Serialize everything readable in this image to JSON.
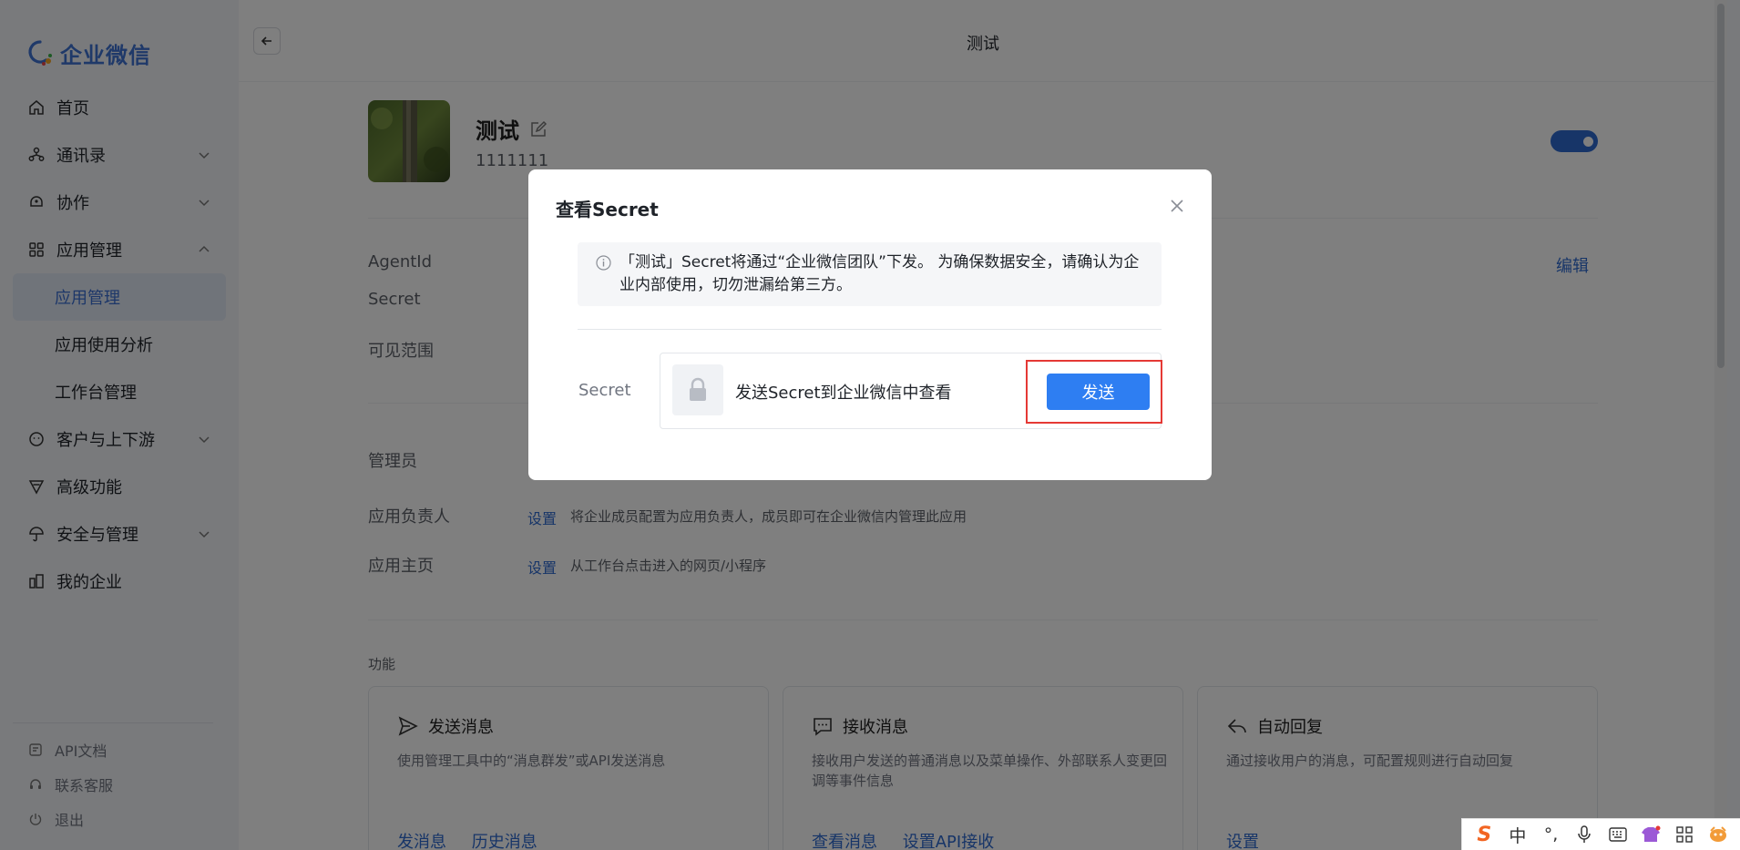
{
  "brand": {
    "name": "企业微信"
  },
  "sidebar": {
    "items": [
      {
        "label": "首页",
        "icon": "home-icon"
      },
      {
        "label": "通讯录",
        "icon": "contacts-icon"
      },
      {
        "label": "协作",
        "icon": "collab-icon"
      },
      {
        "label": "应用管理",
        "icon": "apps-icon"
      },
      {
        "label": "应用管理",
        "sub": true,
        "active": true
      },
      {
        "label": "应用使用分析",
        "sub": true
      },
      {
        "label": "工作台管理",
        "sub": true
      },
      {
        "label": "客户与上下游",
        "icon": "customer-icon"
      },
      {
        "label": "高级功能",
        "icon": "advanced-icon"
      },
      {
        "label": "安全与管理",
        "icon": "security-icon"
      },
      {
        "label": "我的企业",
        "icon": "company-icon"
      }
    ],
    "footer": [
      {
        "label": "API文档"
      },
      {
        "label": "联系客服"
      },
      {
        "label": "退出"
      }
    ]
  },
  "header": {
    "title": "测试"
  },
  "app": {
    "name": "测试",
    "id": "1111111"
  },
  "details": {
    "agentid_label": "AgentId",
    "secret_label": "Secret",
    "visible_label": "可见范围",
    "edit_label": "编辑",
    "admin_label": "管理员",
    "owner_label": "应用负责人",
    "owner_link": "设置",
    "owner_desc": "将企业成员配置为应用负责人，成员即可在企业微信内管理此应用",
    "home_label": "应用主页",
    "home_link": "设置",
    "home_desc": "从工作台点击进入的网页/小程序"
  },
  "features": {
    "section_label": "功能",
    "cards": [
      {
        "title": "发送消息",
        "desc": "使用管理工具中的“消息群发”或API发送消息",
        "links": [
          "发消息",
          "历史消息"
        ]
      },
      {
        "title": "接收消息",
        "desc": "接收用户发送的普通消息以及菜单操作、外部联系人变更回调等事件信息",
        "links": [
          "查看消息",
          "设置API接收"
        ]
      },
      {
        "title": "自动回复",
        "desc": "通过接收用户的消息，可配置规则进行自动回复",
        "links": [
          "设置"
        ]
      }
    ]
  },
  "modal": {
    "title": "查看Secret",
    "notice": "「测试」Secret将通过“企业微信团队”下发。 为确保数据安全，请确认为企业内部使用，切勿泄漏给第三方。",
    "secret_label": "Secret",
    "secret_text": "发送Secret到企业微信中查看",
    "send_label": "发送"
  },
  "ime": {
    "logo": "S",
    "mode": "中",
    "punct": "°,"
  },
  "colors": {
    "accent": "#2e6ad1",
    "button": "#2e7ef2",
    "highlight": "#e53935",
    "brand": "#3f73d3"
  }
}
